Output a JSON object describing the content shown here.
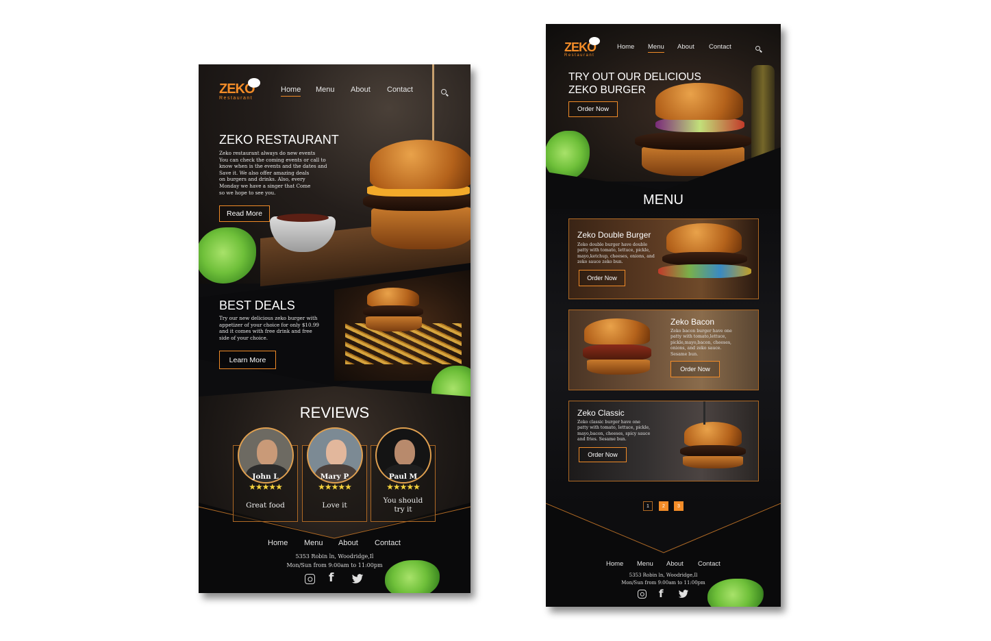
{
  "brand": {
    "name": "ZEKO",
    "sub": "Restaurant"
  },
  "nav": [
    "Home",
    "Menu",
    "About",
    "Contact"
  ],
  "screen1": {
    "hero": {
      "title": "ZEKO RESTAURANT",
      "lines": [
        "Zeko restaurant always do new events",
        "You can check the coming events or call to",
        "know when is the events and the dates and",
        "Save it. We also offer amazing deals",
        "on burgers and drinks. Also, every",
        "Monday we have a singer that Come",
        "so we hope to see you."
      ],
      "button": "Read More"
    },
    "deals": {
      "title": "BEST DEALS",
      "lines": [
        "Try our new delicious zeko burger with",
        "appetizer of your choice for only $10.99",
        "and it comes with free drink and free",
        "side of your choice."
      ],
      "button": "Learn More"
    },
    "reviews": {
      "title": "REVIEWS",
      "items": [
        {
          "name": "John L",
          "stars": "★★★★★",
          "text_lines": [
            "Great food"
          ]
        },
        {
          "name": "Mary P",
          "stars": "★★★★★",
          "text_lines": [
            "Love it"
          ]
        },
        {
          "name": "Paul M",
          "stars": "★★★★★",
          "text_lines": [
            "You should",
            "try it"
          ]
        }
      ]
    }
  },
  "screen2": {
    "hero": {
      "title_lines": [
        "TRY OUT OUR DELICIOUS",
        "ZEKO BURGER"
      ],
      "button": "Order Now"
    },
    "menu_title": "MENU",
    "items": [
      {
        "title": "Zeko Double Burger",
        "lines": [
          "Zeko double burger have double",
          "patty with tomato, lettuce, pickle,",
          "mayo,ketchup, cheeses, onions, and",
          "zeko sauce zeko bun."
        ],
        "button": "Order Now"
      },
      {
        "title": "Zeko Bacon",
        "lines": [
          "Zeko bacon burger have one",
          "patty with tomato,lettuce,",
          "pickle,mayo,bacon, cheeses,",
          "onions, and zeko sauce.",
          "Sesame bun."
        ],
        "button": "Order Now"
      },
      {
        "title": "Zeko Classic",
        "lines": [
          "Zeko classic burger have one",
          "patty with tomato, lettuce, pickle,",
          "mayo,bacon, cheeses, spicy sauce",
          "and fries. Sesame bun."
        ],
        "button": "Order Now"
      }
    ],
    "pages": [
      "1",
      "2",
      "3"
    ]
  },
  "footer": {
    "links": [
      "Home",
      "Menu",
      "About",
      "Contact"
    ],
    "address": "5353 Robin ln, Woodridge,Il",
    "hours": "Mon/Sun from 9:00am to 11:00pm"
  },
  "icons": [
    "search-icon",
    "instagram-icon",
    "facebook-icon",
    "twitter-icon",
    "chef-hat-icon"
  ],
  "colors": {
    "accent": "#f28c28",
    "background": "#0d0d0f",
    "card_border": "#b06a25",
    "stars": "#f5d23c"
  }
}
